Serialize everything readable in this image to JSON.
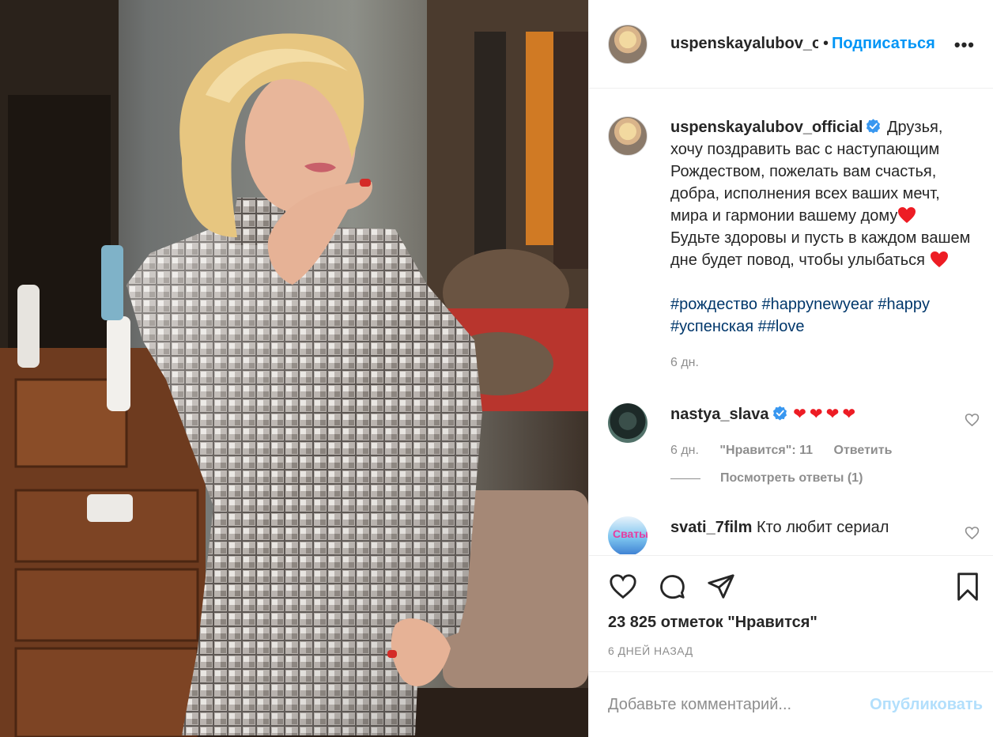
{
  "header": {
    "username": "uspenskayalubov_official",
    "separator": "•",
    "follow_label": "Подписаться",
    "more_icon": "more-horizontal-icon"
  },
  "caption": {
    "username": "uspenskayalubov_official",
    "text_1": "Друзья, хочу поздравить вас с наступающим Рождеством, пожелать вам счастья, добра, исполнения всех ваших мечт, мира и гармонии вашему дому",
    "text_2": "Будьте здоровы и пусть в каждом вашем дне будет повод, чтобы улыбаться",
    "hashtags": "#рождество #happynewyear #happy #успенская ##love",
    "time": "6 дн."
  },
  "comments": [
    {
      "username": "nastya_slava",
      "verified": true,
      "text": "❤❤❤❤",
      "time": "6 дн.",
      "likes": "\"Нравится\": 11",
      "reply_label": "Ответить"
    },
    {
      "username": "svati_7film",
      "verified": false,
      "text": "Кто любит сериал сваты поставьте"
    }
  ],
  "view_replies": "Посмотреть ответы (1)",
  "actions": {
    "like_icon": "heart-icon",
    "comment_icon": "comment-icon",
    "share_icon": "share-icon",
    "save_icon": "bookmark-icon"
  },
  "likes_count": "23 825 отметок \"Нравится\"",
  "posted_ago": "6 ДНЕЙ НАЗАД",
  "add_comment": {
    "placeholder": "Добавьте комментарий...",
    "post_label": "Опубликовать"
  },
  "colors": {
    "accent": "#0095f6",
    "hashtag": "#00376b",
    "muted": "#8e8e8e",
    "post_disabled": "#b2dffc",
    "heart": "#ed1c24"
  }
}
